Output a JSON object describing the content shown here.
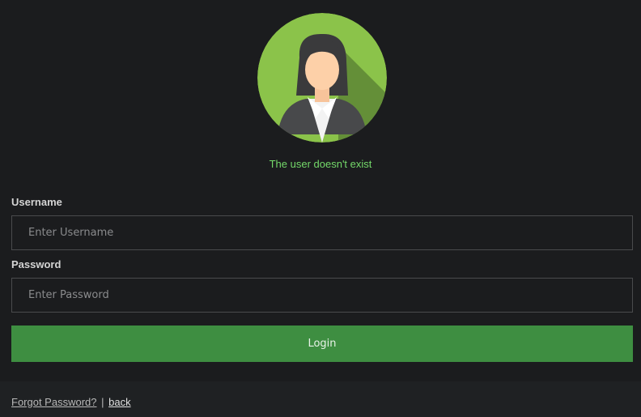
{
  "avatar": {
    "icon": "user-avatar-woman-icon",
    "background": "#8bc34a"
  },
  "status": {
    "message": "The user doesn't exist",
    "color": "#74d96a"
  },
  "form": {
    "username_label": "Username",
    "username_placeholder": "Enter Username",
    "username_value": "",
    "password_label": "Password",
    "password_placeholder": "Enter Password",
    "password_value": "",
    "login_label": "Login",
    "login_color": "#3e8e41"
  },
  "footer": {
    "forgot_label": "Forgot Password?",
    "separator": "|",
    "back_label": "back"
  }
}
